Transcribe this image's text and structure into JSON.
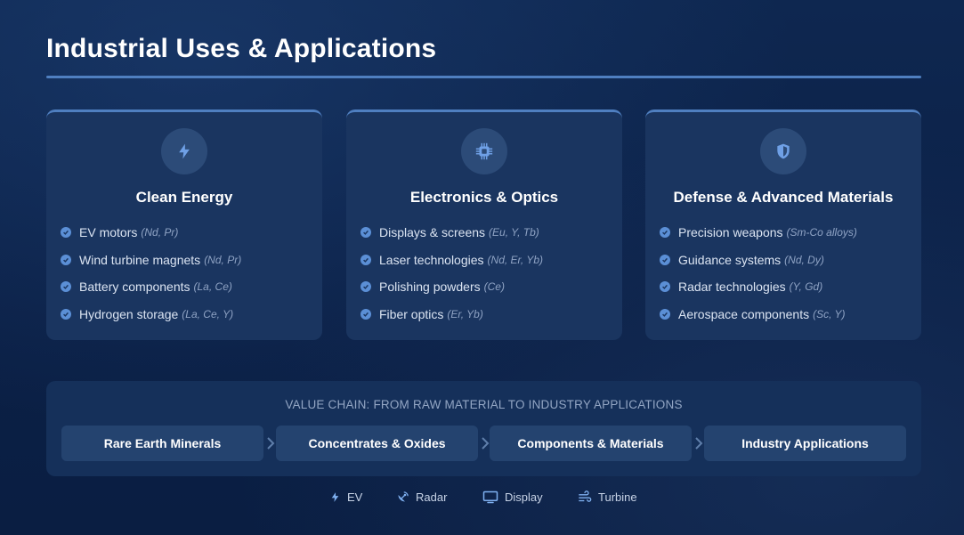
{
  "page": {
    "title": "Industrial Uses & Applications"
  },
  "colors": {
    "background": "#0c2247",
    "card": "#1a3560",
    "accent": "#4f7fc0",
    "check": "#5b8fd6",
    "icon": "#6fa0e6"
  },
  "cards": [
    {
      "icon": "lightning-bolt-icon",
      "title": "Clean Energy",
      "items": [
        {
          "label": "EV motors",
          "elements": "(Nd, Pr)"
        },
        {
          "label": "Wind turbine magnets",
          "elements": "(Nd, Pr)"
        },
        {
          "label": "Battery components",
          "elements": "(La, Ce)"
        },
        {
          "label": "Hydrogen storage",
          "elements": "(La, Ce, Y)"
        }
      ]
    },
    {
      "icon": "microchip-icon",
      "title": "Electronics & Optics",
      "items": [
        {
          "label": "Displays & screens",
          "elements": "(Eu, Y, Tb)"
        },
        {
          "label": "Laser technologies",
          "elements": "(Nd, Er, Yb)"
        },
        {
          "label": "Polishing powders",
          "elements": "(Ce)"
        },
        {
          "label": "Fiber optics",
          "elements": "(Er, Yb)"
        }
      ]
    },
    {
      "icon": "shield-icon",
      "title": "Defense & Advanced Materials",
      "items": [
        {
          "label": "Precision weapons",
          "elements": "(Sm-Co alloys)"
        },
        {
          "label": "Guidance systems",
          "elements": "(Nd, Dy)"
        },
        {
          "label": "Radar technologies",
          "elements": "(Y, Gd)"
        },
        {
          "label": "Aerospace components",
          "elements": "(Sc, Y)"
        }
      ]
    }
  ],
  "value_chain": {
    "label": "VALUE CHAIN: FROM RAW MATERIAL TO INDUSTRY APPLICATIONS",
    "steps": [
      "Rare Earth Minerals",
      "Concentrates & Oxides",
      "Components & Materials",
      "Industry Applications"
    ]
  },
  "legend": [
    {
      "icon": "lightning-bolt-icon",
      "label": "EV"
    },
    {
      "icon": "satellite-dish-icon",
      "label": "Radar"
    },
    {
      "icon": "monitor-icon",
      "label": "Display"
    },
    {
      "icon": "wind-icon",
      "label": "Turbine"
    }
  ]
}
